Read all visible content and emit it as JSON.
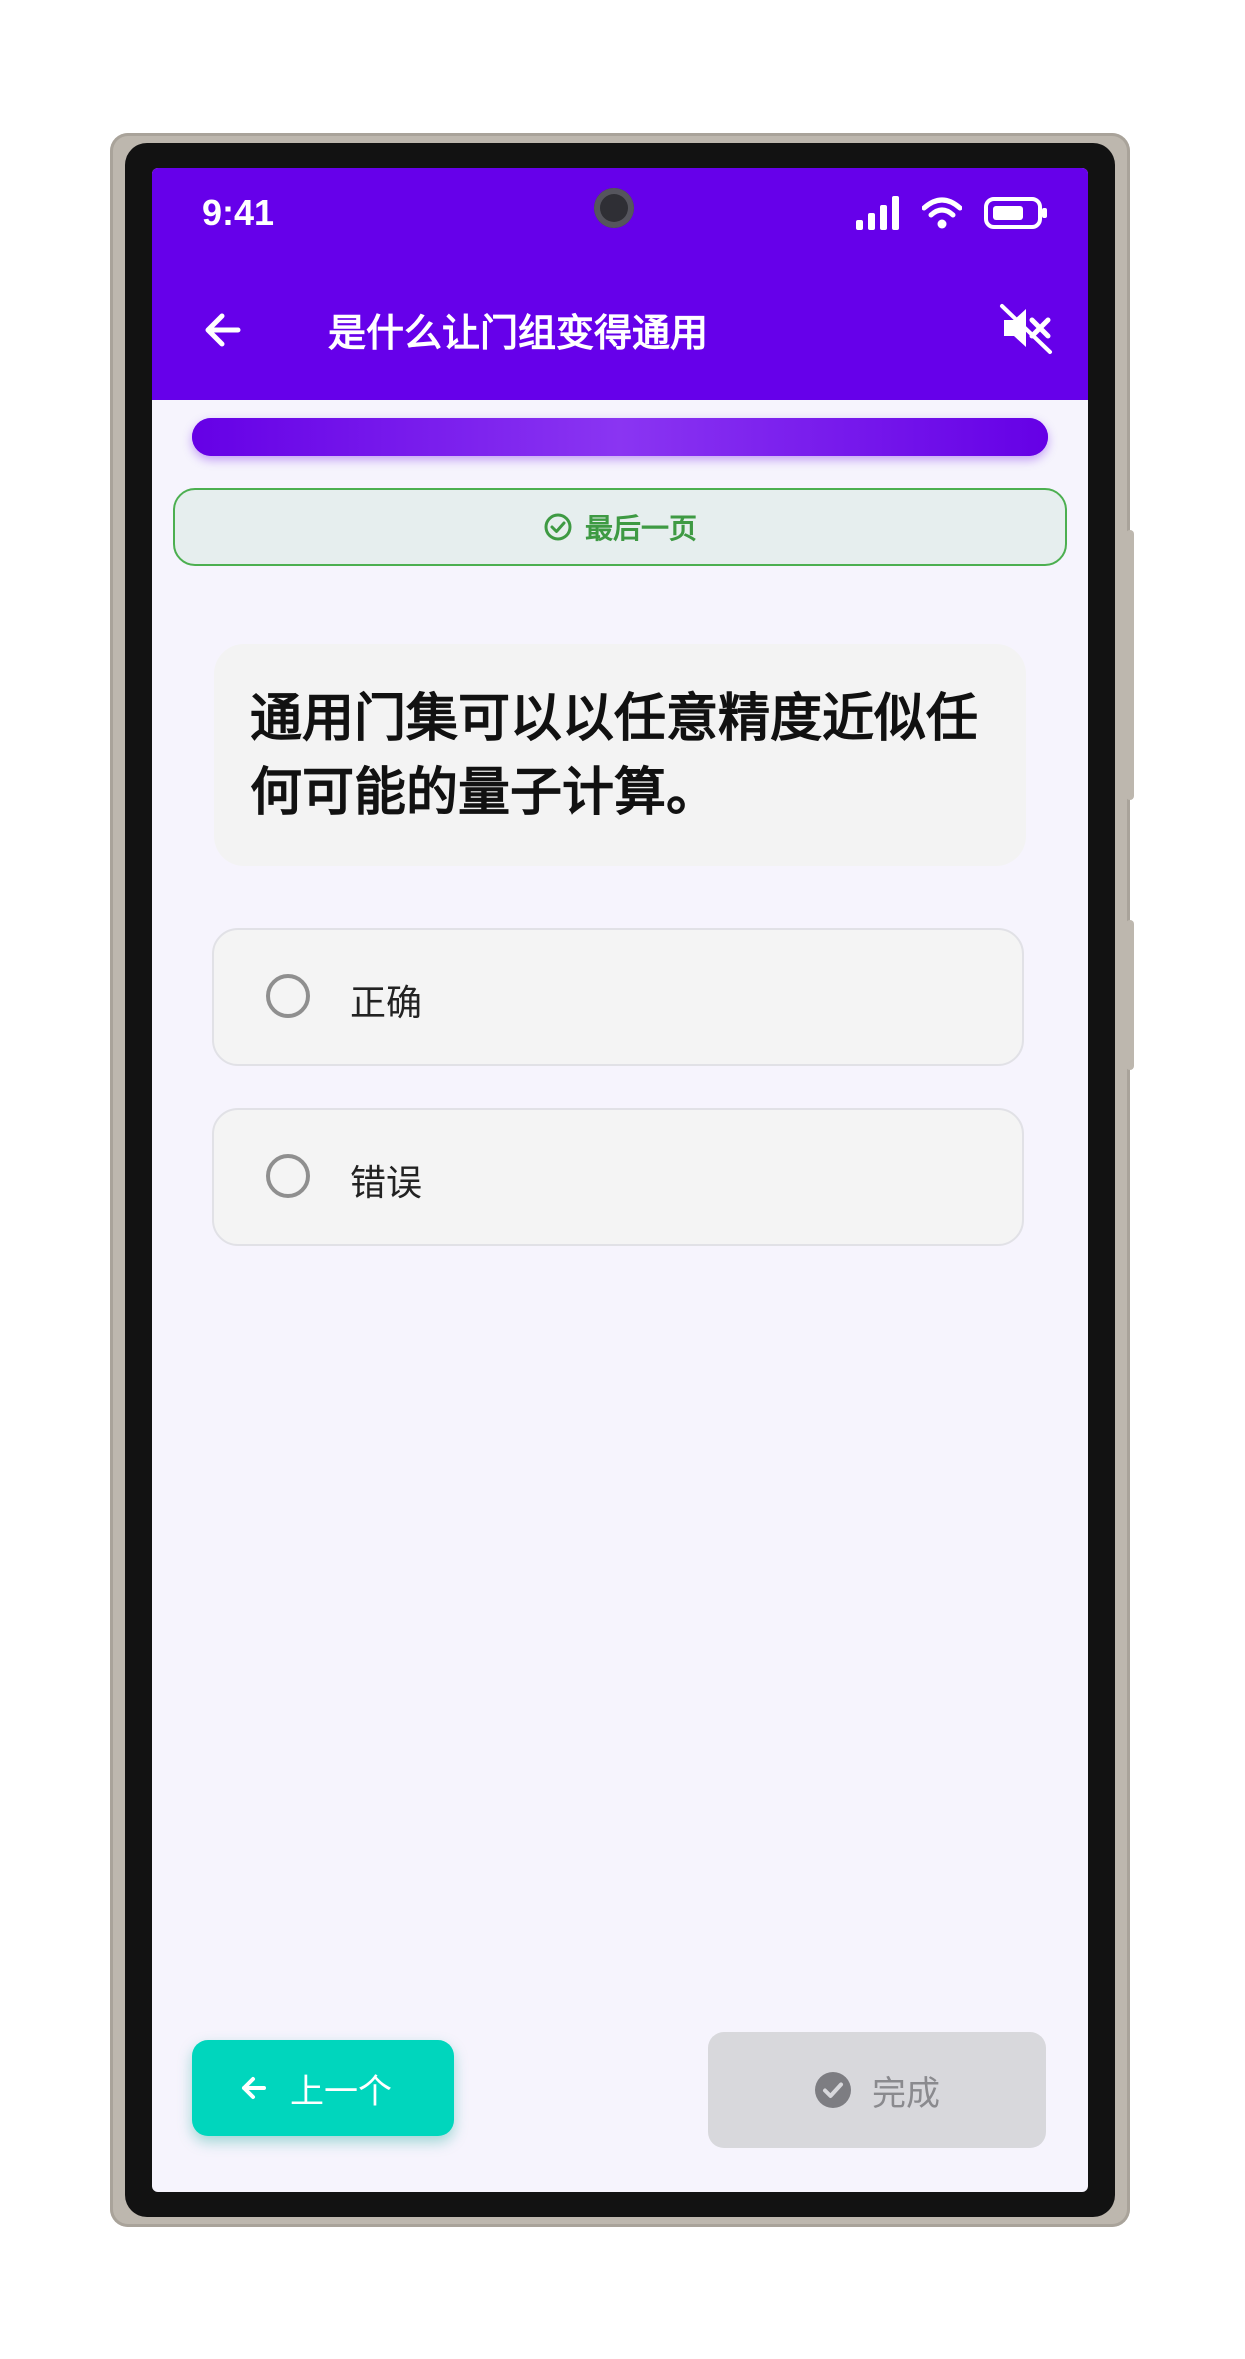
{
  "status_bar": {
    "time": "9:41"
  },
  "app_bar": {
    "title": "是什么让门组变得通用"
  },
  "progress": {
    "fraction": 1.0
  },
  "banner": {
    "text": "最后一页"
  },
  "question": {
    "text": "通用门集可以以任意精度近似任何可能的量子计算。"
  },
  "options": [
    {
      "label": "正确",
      "selected": false
    },
    {
      "label": "错误",
      "selected": false
    }
  ],
  "footer": {
    "prev_label": "上一个",
    "finish_label": "完成"
  },
  "colors": {
    "primary": "#6600ea",
    "success": "#4caf50",
    "accent": "#00d6bd",
    "disabled": "#d8d8dc"
  },
  "icons": {
    "back": "arrow-left-icon",
    "mute": "volume-off-icon",
    "banner": "check-circle-icon",
    "prev": "arrow-left-icon",
    "finish": "check-circle-filled-icon"
  }
}
